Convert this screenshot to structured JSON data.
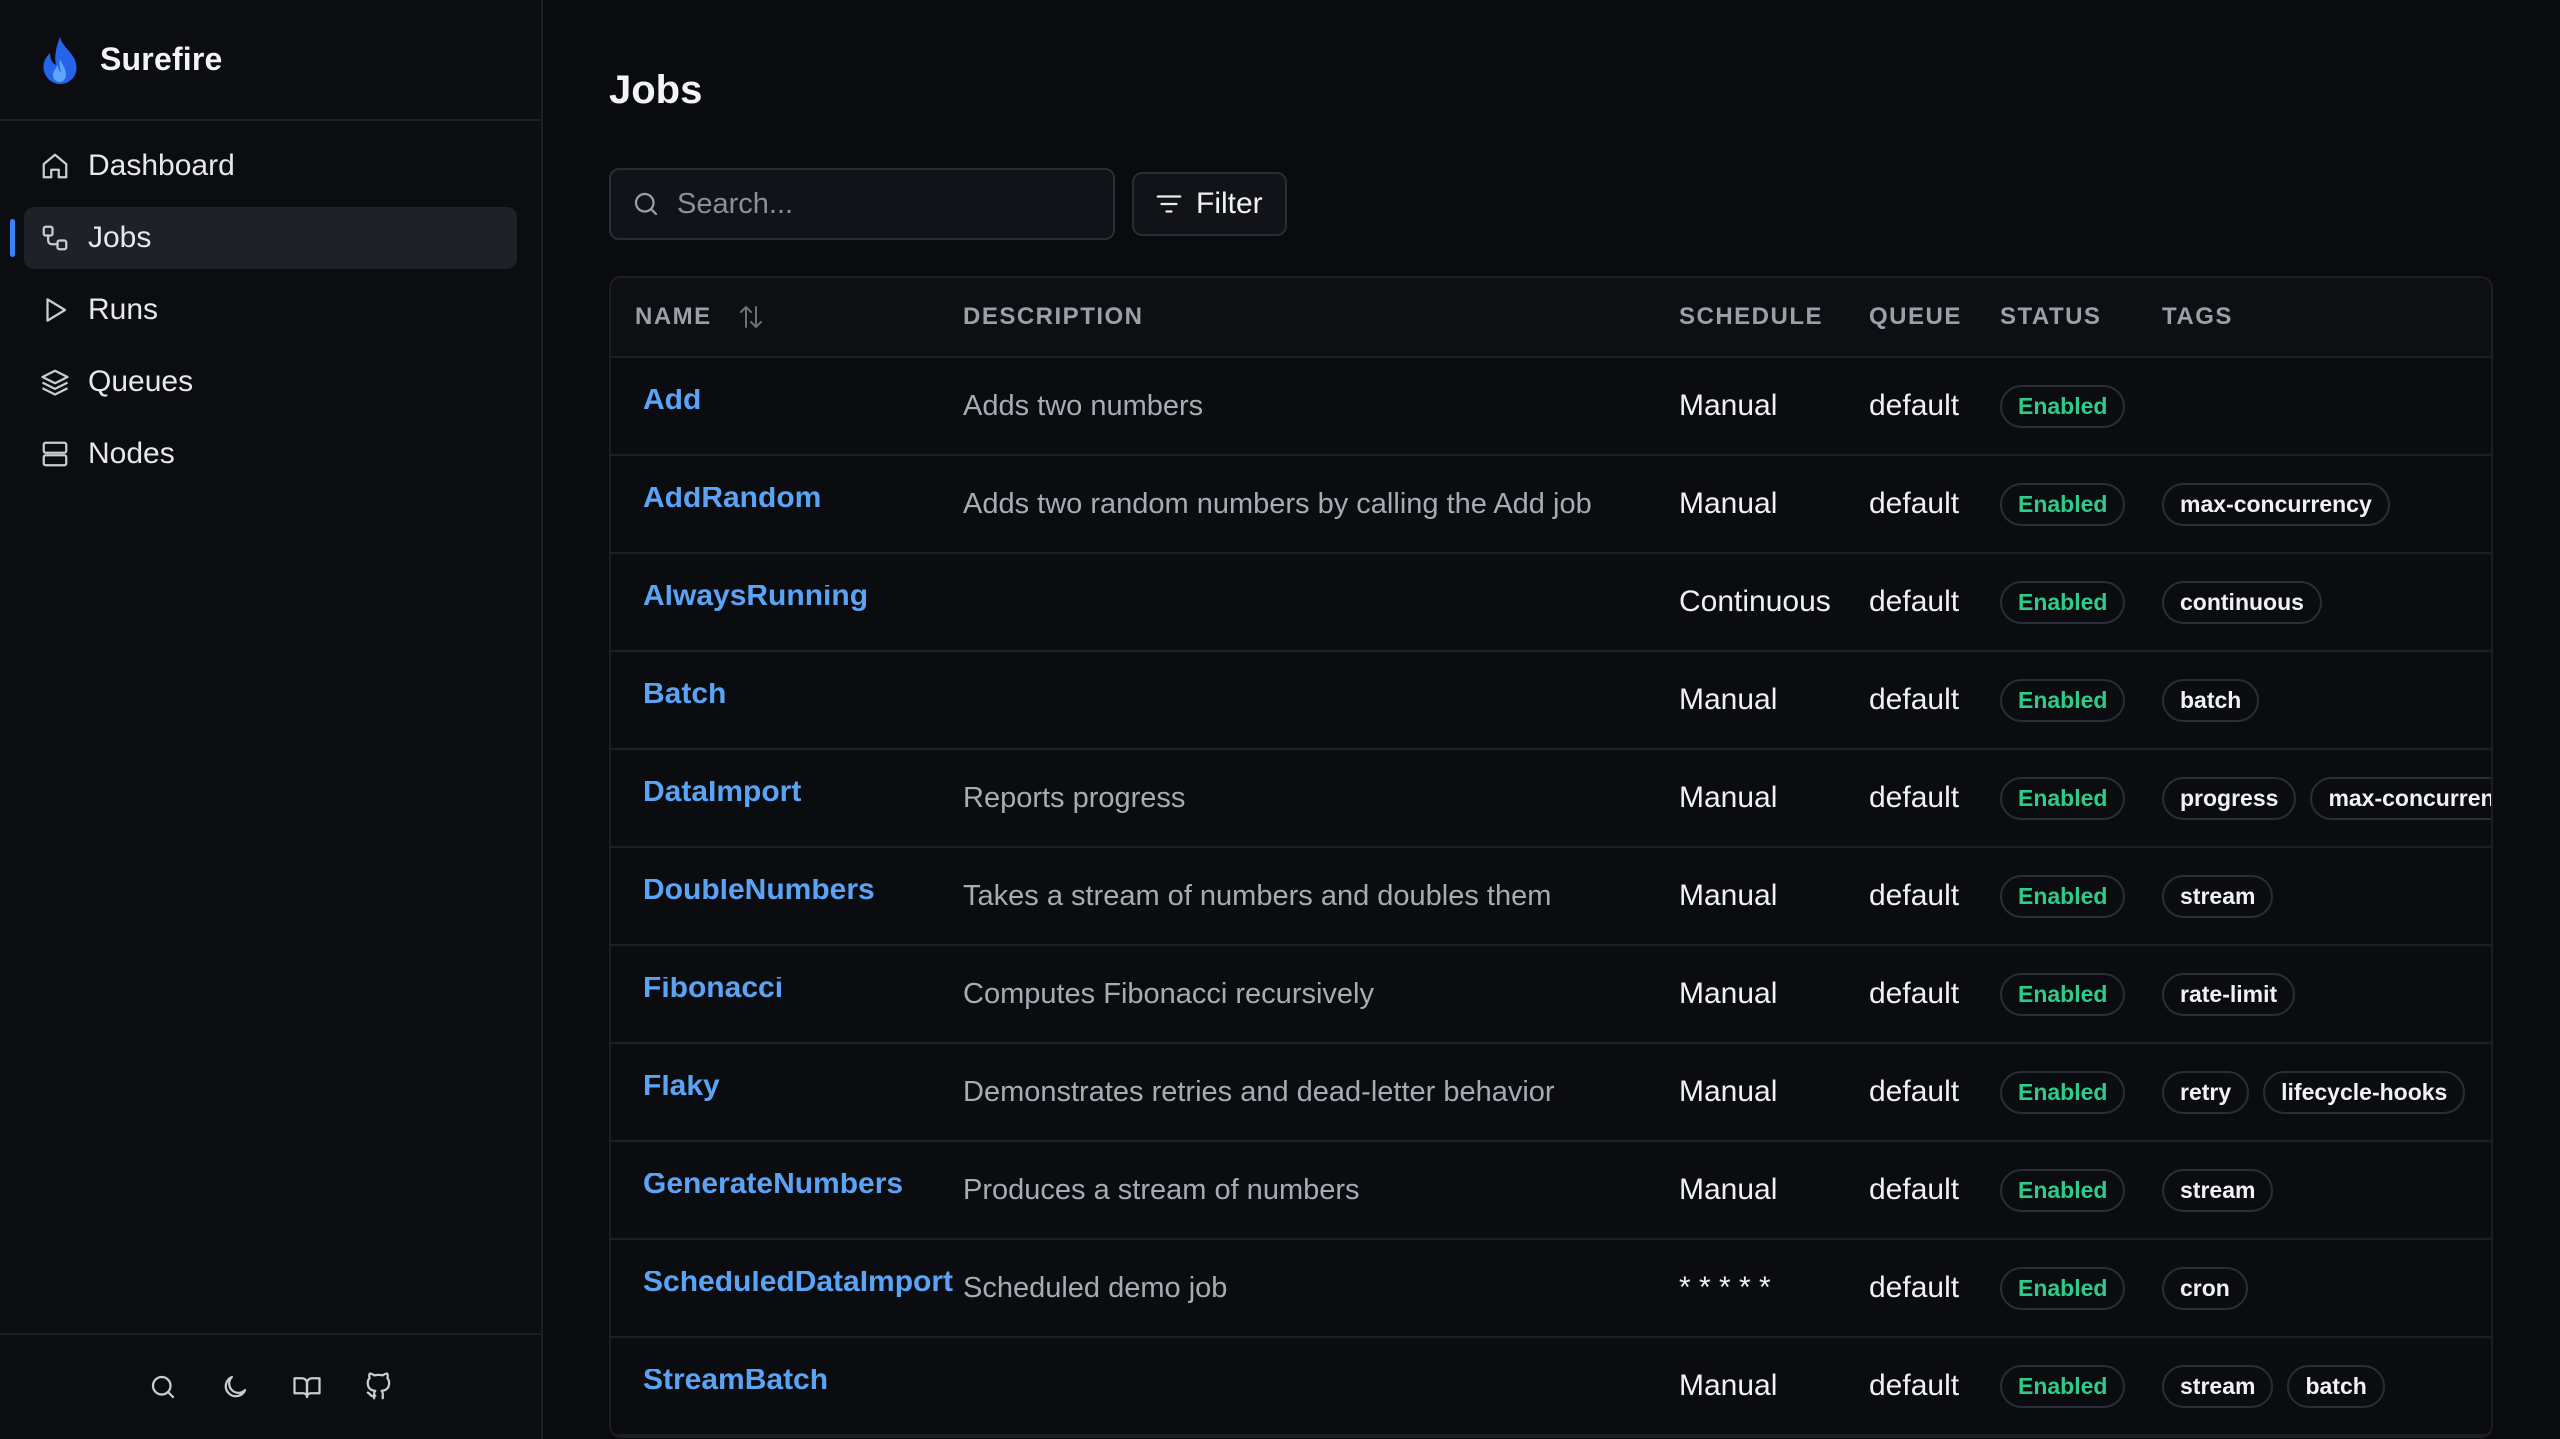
{
  "app": {
    "name": "Surefire"
  },
  "sidebar": {
    "items": [
      {
        "label": "Dashboard",
        "icon": "home-icon"
      },
      {
        "label": "Jobs",
        "icon": "jobs-icon",
        "active": true
      },
      {
        "label": "Runs",
        "icon": "play-icon"
      },
      {
        "label": "Queues",
        "icon": "layers-icon"
      },
      {
        "label": "Nodes",
        "icon": "server-icon"
      }
    ],
    "footer_icons": [
      "search-icon",
      "moon-icon",
      "book-icon",
      "github-icon"
    ]
  },
  "main": {
    "title": "Jobs",
    "search": {
      "placeholder": "Search...",
      "value": ""
    },
    "filter_label": "Filter"
  },
  "table": {
    "columns": [
      "NAME",
      "DESCRIPTION",
      "SCHEDULE",
      "QUEUE",
      "STATUS",
      "TAGS"
    ],
    "rows": [
      {
        "name": "Add",
        "description": "Adds two numbers",
        "schedule": "Manual",
        "queue": "default",
        "status": "Enabled",
        "tags": []
      },
      {
        "name": "AddRandom",
        "description": "Adds two random numbers by calling the Add job",
        "schedule": "Manual",
        "queue": "default",
        "status": "Enabled",
        "tags": [
          "max-concurrency"
        ]
      },
      {
        "name": "AlwaysRunning",
        "description": "",
        "schedule": "Continuous",
        "queue": "default",
        "status": "Enabled",
        "tags": [
          "continuous"
        ]
      },
      {
        "name": "Batch",
        "description": "",
        "schedule": "Manual",
        "queue": "default",
        "status": "Enabled",
        "tags": [
          "batch"
        ]
      },
      {
        "name": "DataImport",
        "description": "Reports progress",
        "schedule": "Manual",
        "queue": "default",
        "status": "Enabled",
        "tags": [
          "progress",
          "max-concurrency"
        ]
      },
      {
        "name": "DoubleNumbers",
        "description": "Takes a stream of numbers and doubles them",
        "schedule": "Manual",
        "queue": "default",
        "status": "Enabled",
        "tags": [
          "stream"
        ]
      },
      {
        "name": "Fibonacci",
        "description": "Computes Fibonacci recursively",
        "schedule": "Manual",
        "queue": "default",
        "status": "Enabled",
        "tags": [
          "rate-limit"
        ]
      },
      {
        "name": "Flaky",
        "description": "Demonstrates retries and dead-letter behavior",
        "schedule": "Manual",
        "queue": "default",
        "status": "Enabled",
        "tags": [
          "retry",
          "lifecycle-hooks"
        ]
      },
      {
        "name": "GenerateNumbers",
        "description": "Produces a stream of numbers",
        "schedule": "Manual",
        "queue": "default",
        "status": "Enabled",
        "tags": [
          "stream"
        ]
      },
      {
        "name": "ScheduledDataImport",
        "description": "Scheduled demo job",
        "schedule": "* * * * *",
        "queue": "default",
        "status": "Enabled",
        "tags": [
          "cron"
        ]
      },
      {
        "name": "StreamBatch",
        "description": "",
        "schedule": "Manual",
        "queue": "default",
        "status": "Enabled",
        "tags": [
          "stream",
          "batch"
        ]
      }
    ]
  }
}
